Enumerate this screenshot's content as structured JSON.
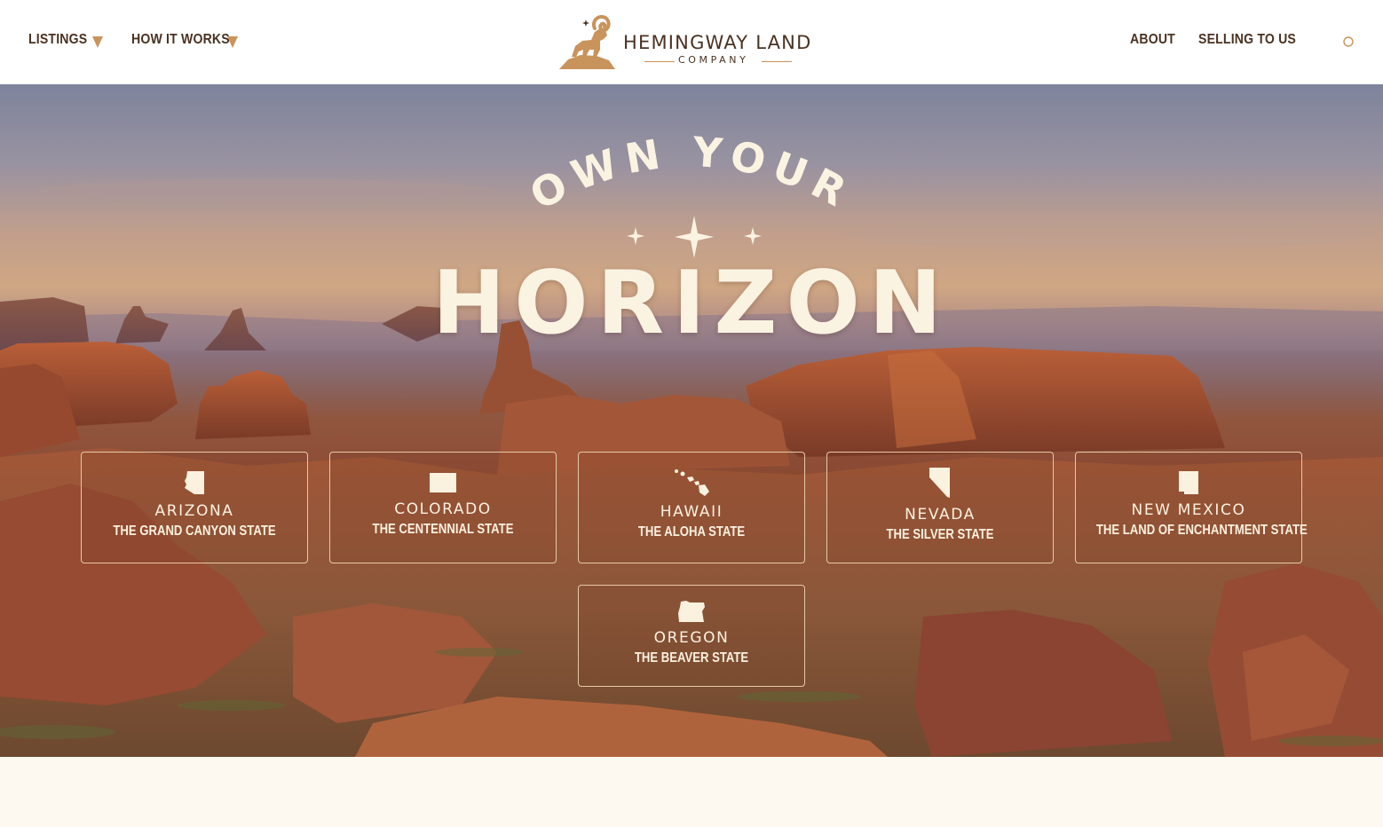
{
  "header": {
    "nav_left": [
      {
        "label": "LISTINGS"
      },
      {
        "label": "HOW IT WORKS"
      }
    ],
    "logo": {
      "name": "HEMINGWAY LAND",
      "sub": "COMPANY"
    },
    "nav_right": [
      {
        "label": "ABOUT"
      },
      {
        "label": "SELLING TO US"
      }
    ]
  },
  "hero": {
    "arc_text": "OWN YOUR",
    "title": "HORIZON",
    "states": [
      {
        "name": "ARIZONA",
        "nickname": "THE GRAND CANYON STATE",
        "icon": "arizona-shape-icon"
      },
      {
        "name": "COLORADO",
        "nickname": "THE CENTENNIAL STATE",
        "icon": "colorado-shape-icon"
      },
      {
        "name": "HAWAII",
        "nickname": "THE ALOHA STATE",
        "icon": "hawaii-shape-icon"
      },
      {
        "name": "NEVADA",
        "nickname": "THE SILVER STATE",
        "icon": "nevada-shape-icon"
      },
      {
        "name": "NEW MEXICO",
        "nickname": "THE LAND OF ENCHANTMENT STATE",
        "icon": "new-mexico-shape-icon"
      },
      {
        "name": "OREGON",
        "nickname": "THE BEAVER STATE",
        "icon": "oregon-shape-icon"
      }
    ]
  },
  "colors": {
    "brand_brown": "#4a3222",
    "accent_tan": "#c9935c",
    "cream": "#fbf3e2"
  }
}
